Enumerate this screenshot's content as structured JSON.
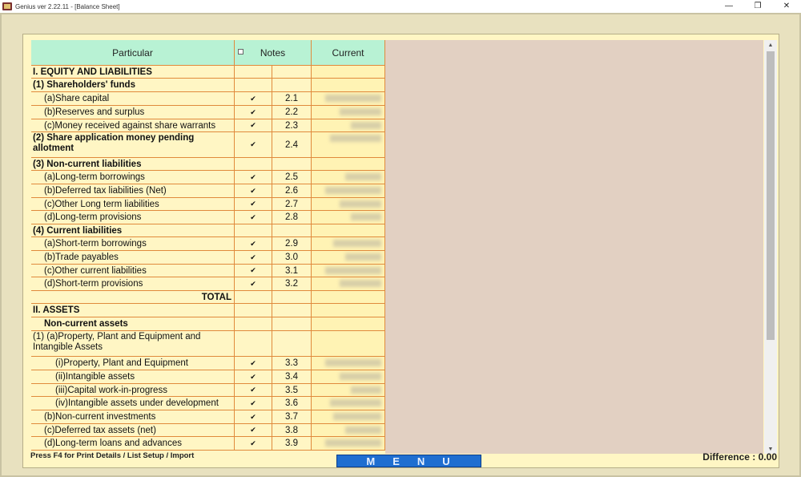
{
  "window": {
    "title": "Genius ver 2.22.11 - [Balance Sheet]",
    "minimize": "—",
    "restore": "❐",
    "close": "✕"
  },
  "grid": {
    "headers": {
      "particular": "Particular",
      "notes": "Notes",
      "current": "Current"
    },
    "rows": [
      {
        "label": "I. EQUITY AND LIABILITIES",
        "bold": true,
        "check": false,
        "note": "",
        "h": 16
      },
      {
        "label": "(1) Shareholders' funds",
        "bold": true,
        "check": false,
        "note": "",
        "h": 17
      },
      {
        "label": "(a)Share capital",
        "indent": 16,
        "check": true,
        "note": "2.1",
        "h": 17
      },
      {
        "label": "(b)Reserves and surplus",
        "indent": 16,
        "check": true,
        "note": "2.2",
        "h": 17
      },
      {
        "label": "(c)Money received against share warrants",
        "indent": 16,
        "check": true,
        "note": "2.3",
        "h": 16
      },
      {
        "label": "(2) Share application money pending allotment",
        "bold": true,
        "wrap": true,
        "check": true,
        "note": "2.4",
        "h": 32
      },
      {
        "label": "(3) Non-current liabilities",
        "bold": true,
        "check": false,
        "note": "",
        "h": 16
      },
      {
        "label": "(a)Long-term borrowings",
        "indent": 16,
        "check": true,
        "note": "2.5",
        "h": 17
      },
      {
        "label": "(b)Deferred tax liabilities (Net)",
        "indent": 16,
        "check": true,
        "note": "2.6",
        "h": 17
      },
      {
        "label": "(c)Other Long term liabilities",
        "indent": 16,
        "check": true,
        "note": "2.7",
        "h": 16
      },
      {
        "label": "(d)Long-term provisions",
        "indent": 16,
        "check": true,
        "note": "2.8",
        "h": 17
      },
      {
        "label": "(4) Current liabilities",
        "bold": true,
        "check": false,
        "note": "",
        "h": 16
      },
      {
        "label": "(a)Short-term borrowings",
        "indent": 16,
        "check": true,
        "note": "2.9",
        "h": 17
      },
      {
        "label": "(b)Trade payables",
        "indent": 16,
        "check": true,
        "note": "3.0",
        "h": 17
      },
      {
        "label": "(c)Other current liabilities",
        "indent": 16,
        "check": true,
        "note": "3.1",
        "h": 16
      },
      {
        "label": "(d)Short-term provisions",
        "indent": 16,
        "check": true,
        "note": "3.2",
        "h": 17
      },
      {
        "label": "TOTAL",
        "bold": true,
        "right": true,
        "check": false,
        "note": "",
        "h": 16
      },
      {
        "label": "II. ASSETS",
        "bold": true,
        "check": false,
        "note": "",
        "h": 17
      },
      {
        "label": "Non-current assets",
        "bold": true,
        "indent": 16,
        "check": false,
        "note": "",
        "h": 17
      },
      {
        "label": "(1) (a)Property, Plant and Equipment and Intangible Assets",
        "wrap": true,
        "check": false,
        "note": "",
        "h": 32
      },
      {
        "label": "(i)Property, Plant and Equipment",
        "indent": 30,
        "check": true,
        "note": "3.3",
        "h": 17
      },
      {
        "label": "(ii)Intangible assets",
        "indent": 30,
        "check": true,
        "note": "3.4",
        "h": 17
      },
      {
        "label": "(iii)Capital work-in-progress",
        "indent": 30,
        "check": true,
        "note": "3.5",
        "h": 16
      },
      {
        "label": "(iv)Intangible assets under development",
        "indent": 30,
        "check": true,
        "note": "3.6",
        "h": 17
      },
      {
        "label": "(b)Non-current investments",
        "indent": 16,
        "check": true,
        "note": "3.7",
        "h": 17
      },
      {
        "label": "(c)Deferred tax assets (net)",
        "indent": 16,
        "check": true,
        "note": "3.8",
        "h": 16
      },
      {
        "label": "(d)Long-term loans and advances",
        "indent": 16,
        "check": true,
        "note": "3.9",
        "h": 17
      }
    ]
  },
  "status": {
    "hint": "Press F4 for Print Details / List Setup / Import",
    "menu_label": "MENU",
    "difference": "Difference : 0.00"
  },
  "colors": {
    "header_bg": "#b8f2d4",
    "grid_line": "#e08a3c",
    "row_bg": "#fff6c4",
    "report_bg": "#e2d0c2",
    "menu_bg": "#1f6ed0"
  }
}
